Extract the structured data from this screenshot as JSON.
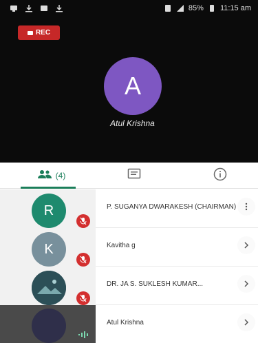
{
  "status_bar": {
    "time": "11:15 am",
    "battery": "85%"
  },
  "recording": {
    "label": "REC"
  },
  "active_speaker": {
    "initial": "A",
    "name": "Atul Krishna",
    "color": "#7e57c2"
  },
  "tabs": {
    "people_label": "(4)",
    "people_icon": "people-icon",
    "chat_icon": "chat-icon",
    "info_icon": "info-icon",
    "accent": "#1b7e5a"
  },
  "participants": [
    {
      "initial": "R",
      "name": "P. SUGANYA DWARAKESH (CHAIRMAN)",
      "avatar_color": "#1e8a6e",
      "muted": true
    },
    {
      "initial": "K",
      "name": "Kavitha g",
      "avatar_color": "#78909c",
      "muted": true
    },
    {
      "initial": "",
      "name": "DR. JA S. SUKLESH KUMAR...",
      "avatar_color": "#3d6b73",
      "muted": true
    },
    {
      "initial": "",
      "name": "Atul Krishna",
      "avatar_color": "#2f2f4a",
      "muted": false
    }
  ]
}
